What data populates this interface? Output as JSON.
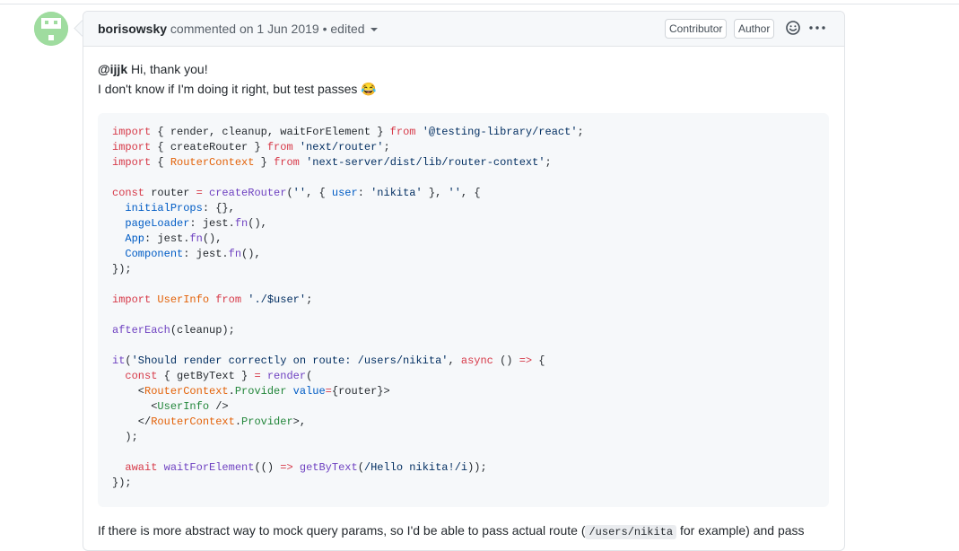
{
  "comment": {
    "author": "borisowsky",
    "meta": "commented on 1 Jun 2019",
    "separator": "•",
    "edited_label": "edited",
    "badges": {
      "contributor": "Contributor",
      "author": "Author"
    },
    "icons": {
      "emoji": "smiley-icon",
      "more": "kebab-horizontal-icon",
      "avatar": "identicon-avatar"
    },
    "body": {
      "mention": "@ijjk",
      "greeting": " Hi, thank you!",
      "line2": "I don't know if I'm doing it right, but test passes 😂",
      "footer_before": "If there is more abstract way to mock query params, so I'd be able to pass actual route (",
      "footer_code": "/users/nikita",
      "footer_after": " for example) and pass"
    }
  },
  "code_lines": [
    [
      [
        "k",
        "import"
      ],
      [
        "p",
        " { render, cleanup, waitForElement } "
      ],
      [
        "k",
        "from"
      ],
      [
        "p",
        " "
      ],
      [
        "s",
        "'@testing-library/react'"
      ],
      [
        "p",
        ";"
      ]
    ],
    [
      [
        "k",
        "import"
      ],
      [
        "p",
        " { createRouter } "
      ],
      [
        "k",
        "from"
      ],
      [
        "p",
        " "
      ],
      [
        "s",
        "'next/router'"
      ],
      [
        "p",
        ";"
      ]
    ],
    [
      [
        "k",
        "import"
      ],
      [
        "p",
        " { "
      ],
      [
        "o",
        "RouterContext"
      ],
      [
        "p",
        " } "
      ],
      [
        "k",
        "from"
      ],
      [
        "p",
        " "
      ],
      [
        "s",
        "'next-server/dist/lib/router-context'"
      ],
      [
        "p",
        ";"
      ]
    ],
    [],
    [
      [
        "k",
        "const"
      ],
      [
        "p",
        " router "
      ],
      [
        "k",
        "="
      ],
      [
        "p",
        " "
      ],
      [
        "f",
        "createRouter"
      ],
      [
        "p",
        "("
      ],
      [
        "s",
        "''"
      ],
      [
        "p",
        ", { "
      ],
      [
        "c1",
        "user"
      ],
      [
        "p",
        ": "
      ],
      [
        "s",
        "'nikita'"
      ],
      [
        "p",
        " }, "
      ],
      [
        "s",
        "''"
      ],
      [
        "p",
        ", {"
      ]
    ],
    [
      [
        "p",
        "  "
      ],
      [
        "c1",
        "initialProps"
      ],
      [
        "p",
        ": {},"
      ]
    ],
    [
      [
        "p",
        "  "
      ],
      [
        "c1",
        "pageLoader"
      ],
      [
        "p",
        ": jest."
      ],
      [
        "f",
        "fn"
      ],
      [
        "p",
        "(),"
      ]
    ],
    [
      [
        "p",
        "  "
      ],
      [
        "c1",
        "App"
      ],
      [
        "p",
        ": jest."
      ],
      [
        "f",
        "fn"
      ],
      [
        "p",
        "(),"
      ]
    ],
    [
      [
        "p",
        "  "
      ],
      [
        "c1",
        "Component"
      ],
      [
        "p",
        ": jest."
      ],
      [
        "f",
        "fn"
      ],
      [
        "p",
        "(),"
      ]
    ],
    [
      [
        "p",
        "});"
      ]
    ],
    [],
    [
      [
        "k",
        "import"
      ],
      [
        "p",
        " "
      ],
      [
        "o",
        "UserInfo"
      ],
      [
        "p",
        " "
      ],
      [
        "k",
        "from"
      ],
      [
        "p",
        " "
      ],
      [
        "s",
        "'./$user'"
      ],
      [
        "p",
        ";"
      ]
    ],
    [],
    [
      [
        "f",
        "afterEach"
      ],
      [
        "p",
        "(cleanup);"
      ]
    ],
    [],
    [
      [
        "f",
        "it"
      ],
      [
        "p",
        "("
      ],
      [
        "s",
        "'Should render correctly on route: /users/nikita'"
      ],
      [
        "p",
        ", "
      ],
      [
        "k",
        "async"
      ],
      [
        "p",
        " () "
      ],
      [
        "k",
        "=>"
      ],
      [
        "p",
        " {"
      ]
    ],
    [
      [
        "p",
        "  "
      ],
      [
        "k",
        "const"
      ],
      [
        "p",
        " { getByText } "
      ],
      [
        "k",
        "="
      ],
      [
        "p",
        " "
      ],
      [
        "f",
        "render"
      ],
      [
        "p",
        "("
      ]
    ],
    [
      [
        "p",
        "    <"
      ],
      [
        "o",
        "RouterContext"
      ],
      [
        "p",
        "."
      ],
      [
        "t",
        "Provider"
      ],
      [
        "p",
        " "
      ],
      [
        "c1",
        "value"
      ],
      [
        "k",
        "="
      ],
      [
        "p",
        "{router}>"
      ]
    ],
    [
      [
        "p",
        "      <"
      ],
      [
        "t",
        "UserInfo"
      ],
      [
        "p",
        " />"
      ]
    ],
    [
      [
        "p",
        "    </"
      ],
      [
        "o",
        "RouterContext"
      ],
      [
        "p",
        "."
      ],
      [
        "t",
        "Provider"
      ],
      [
        "p",
        ">,"
      ]
    ],
    [
      [
        "p",
        "  );"
      ]
    ],
    [],
    [
      [
        "p",
        "  "
      ],
      [
        "k",
        "await"
      ],
      [
        "p",
        " "
      ],
      [
        "f",
        "waitForElement"
      ],
      [
        "p",
        "(() "
      ],
      [
        "k",
        "=>"
      ],
      [
        "p",
        " "
      ],
      [
        "f",
        "getByText"
      ],
      [
        "p",
        "("
      ],
      [
        "s",
        "/Hello nikita!/i"
      ],
      [
        "p",
        "));"
      ]
    ],
    [
      [
        "p",
        "});"
      ]
    ]
  ]
}
